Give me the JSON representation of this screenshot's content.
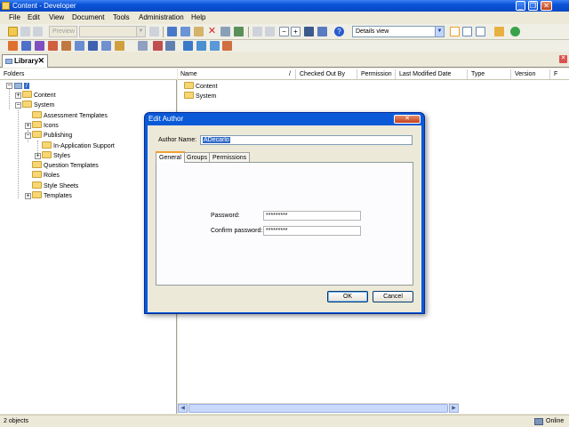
{
  "window": {
    "title": "Content - Developer"
  },
  "menu": [
    "File",
    "Edit",
    "View",
    "Document",
    "Tools",
    "Administration",
    "Help"
  ],
  "toolbar": {
    "preview_label": "Preview",
    "view_combo": "Details view"
  },
  "library_tab": {
    "label": "Library"
  },
  "folders": {
    "header": "Folders",
    "root": "/",
    "items": [
      {
        "label": "Content"
      },
      {
        "label": "System"
      },
      {
        "label": "Assessment Templates"
      },
      {
        "label": "Icons"
      },
      {
        "label": "Publishing"
      },
      {
        "label": "In-Application Support"
      },
      {
        "label": "Styles"
      },
      {
        "label": "Question Templates"
      },
      {
        "label": "Roles"
      },
      {
        "label": "Style Sheets"
      },
      {
        "label": "Templates"
      }
    ]
  },
  "files": {
    "columns": [
      "Name",
      "/",
      "Checked Out By",
      "Permission",
      "Last Modified Date",
      "Type",
      "Version",
      "F"
    ],
    "rows": [
      {
        "name": "Content"
      },
      {
        "name": "System"
      }
    ]
  },
  "status": {
    "left": "2 objects",
    "right": "Online"
  },
  "dialog": {
    "title": "Edit Author",
    "author_name_label": "Author Name:",
    "author_name_value": "ADecarlo",
    "tabs": [
      "General",
      "Groups",
      "Permissions"
    ],
    "password_label": "Password:",
    "password_value": "*********",
    "confirm_label": "Confirm password:",
    "confirm_value": "*********",
    "ok_label": "OK",
    "cancel_label": "Cancel"
  },
  "colors": {
    "titlebar": "#0a53d8",
    "dialog_frame": "#0a5ad8",
    "selection": "#316ac5",
    "folder": "#f7d774"
  }
}
